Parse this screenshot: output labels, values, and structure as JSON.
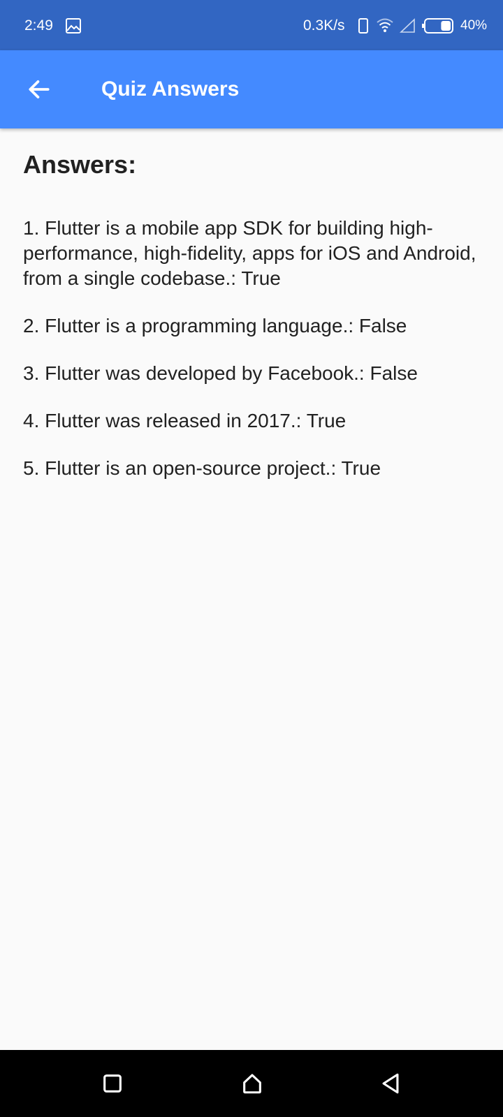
{
  "status_bar": {
    "time": "2:49",
    "network_speed": "0.3K/s",
    "battery_percent": "40%",
    "battery_level": 0.4,
    "icons": [
      "gallery-icon",
      "vibrate-icon",
      "wifi-icon",
      "signal-icon",
      "battery-icon"
    ]
  },
  "app_bar": {
    "title": "Quiz Answers",
    "back_icon": "arrow-back-icon",
    "background_color": "#448aff"
  },
  "content": {
    "heading": "Answers:",
    "answers": [
      {
        "text": "1. Flutter is a mobile app SDK for building high-performance, high-fidelity, apps for iOS and Android, from a single codebase.: True"
      },
      {
        "text": "2. Flutter is a programming language.: False"
      },
      {
        "text": "3. Flutter was developed by Facebook.: False"
      },
      {
        "text": "4. Flutter was released in 2017.: True"
      },
      {
        "text": "5. Flutter is an open-source project.: True"
      }
    ]
  },
  "nav_bar": {
    "buttons": [
      "recents-icon",
      "home-icon",
      "back-icon"
    ]
  }
}
